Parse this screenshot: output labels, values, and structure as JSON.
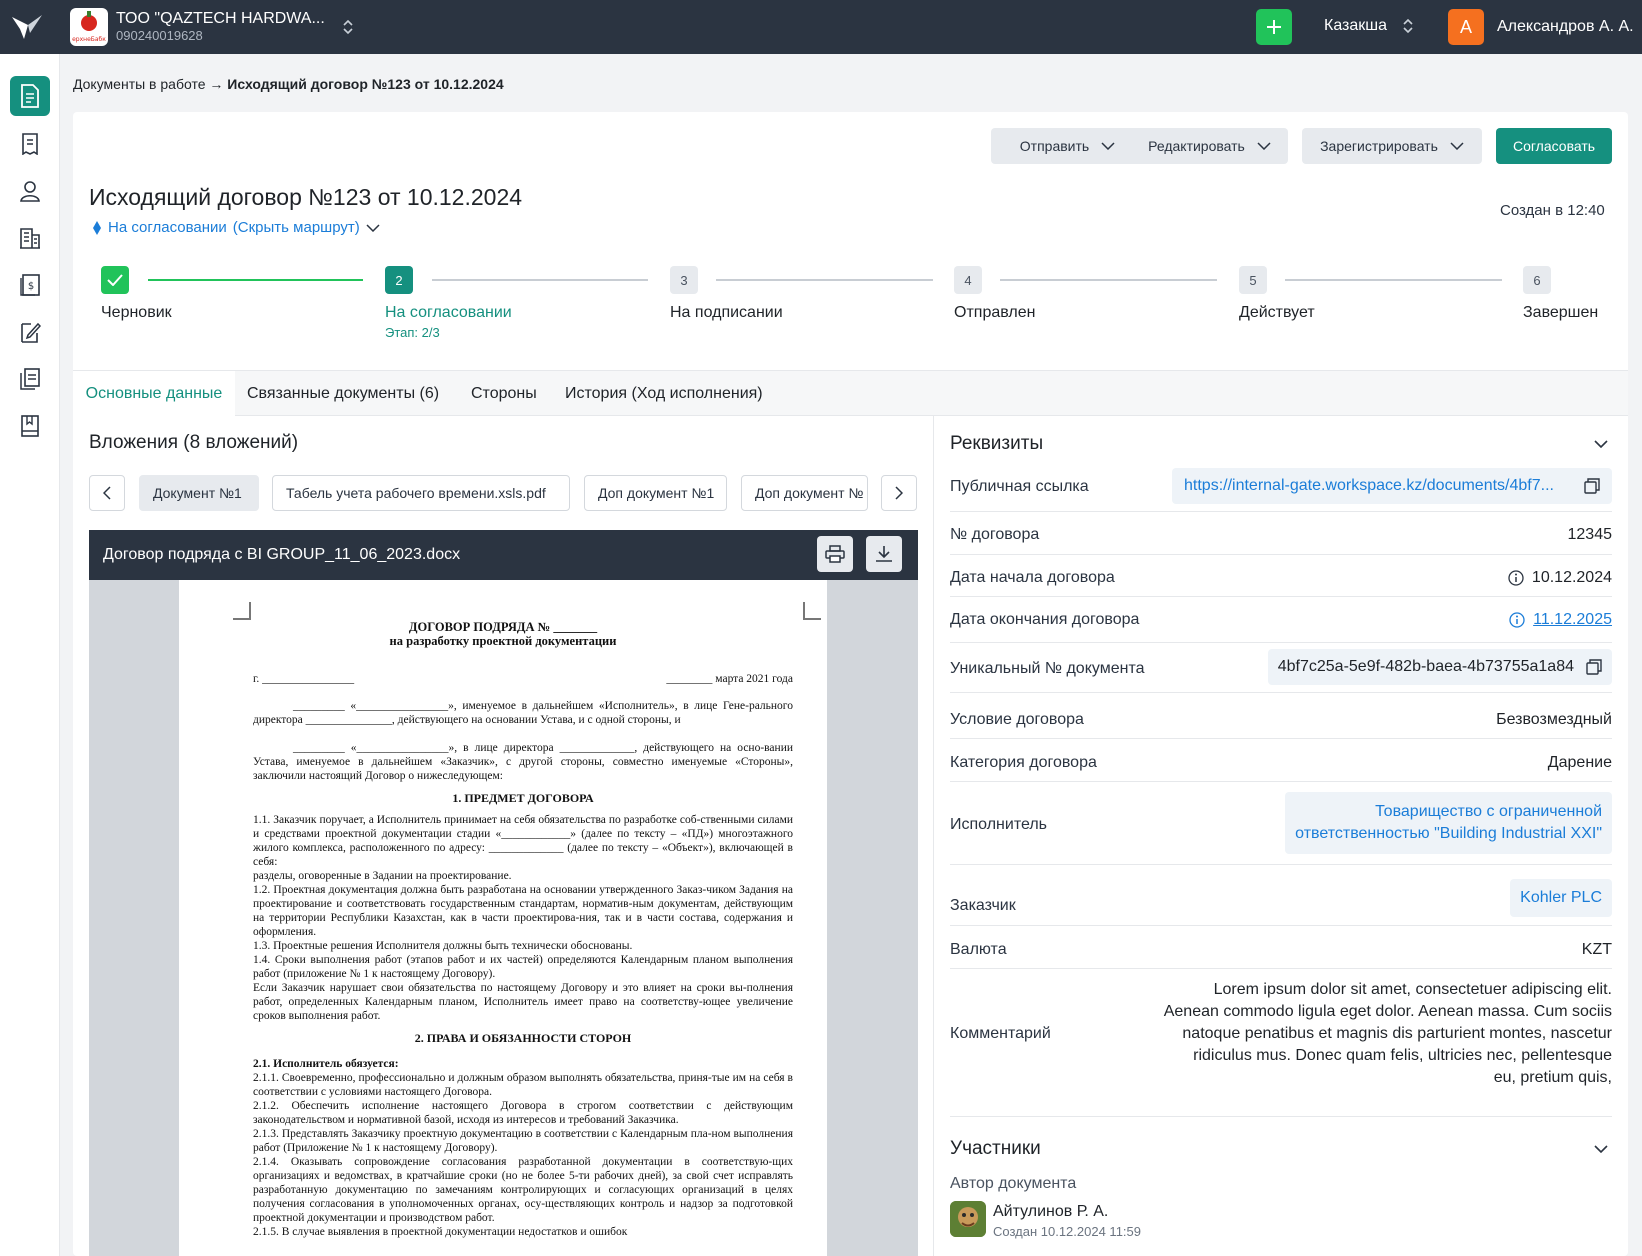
{
  "header": {
    "org_name": "ТОО \"QAZTECH HARDWA...",
    "org_id": "090240019628",
    "org_logo_text": "ерхнеБабк",
    "language": "Казакша",
    "user_initial": "А",
    "user_name": "Александров А. А."
  },
  "sidebar": {
    "items": [
      {
        "icon": "document-icon",
        "active": true
      },
      {
        "icon": "receipt-icon"
      },
      {
        "icon": "user-icon"
      },
      {
        "icon": "building-icon"
      },
      {
        "icon": "invoice-icon"
      },
      {
        "icon": "edit-document-icon"
      },
      {
        "icon": "documents-icon"
      },
      {
        "icon": "bookmark-book-icon"
      }
    ]
  },
  "breadcrumb": {
    "parent": "Документы в работе",
    "arrow": "→",
    "current": "Исходящий договор №123 от 10.12.2024"
  },
  "actions": {
    "send": "Отправить",
    "edit": "Редактировать",
    "register": "Зарегистрировать",
    "approve": "Согласовать"
  },
  "document": {
    "title": "Исходящий договор №123 от 10.12.2024",
    "status": "На согласовании",
    "route_toggle": "(Скрыть маршрут)",
    "created": "Создан в 12:40"
  },
  "stepper": {
    "steps": [
      {
        "num": "1",
        "label": "Черновик",
        "state": "done"
      },
      {
        "num": "2",
        "label": "На согласовании",
        "state": "active",
        "sub": "Этап: 2/3"
      },
      {
        "num": "3",
        "label": "На подписании",
        "state": "pending"
      },
      {
        "num": "4",
        "label": "Отправлен",
        "state": "pending"
      },
      {
        "num": "5",
        "label": "Действует",
        "state": "pending"
      },
      {
        "num": "6",
        "label": "Завершен",
        "state": "pending"
      }
    ]
  },
  "tabs": [
    "Основные данные",
    "Связанные документы (6)",
    "Стороны",
    "История (Ход исполнения)"
  ],
  "attachments": {
    "title": "Вложения (8 вложений)",
    "chips": [
      "Документ №1",
      "Табель учета рабочего времени.xsls.pdf",
      "Доп документ №1",
      "Доп документ №"
    ],
    "viewer_title": "Договор подряда с BI GROUP_11_06_2023.docx"
  },
  "doc_page": {
    "h1": "ДОГОВОР ПОДРЯДА № _______",
    "h2": "на разработку проектной документации",
    "city": "г. ________________",
    "date": "________ марта 2021 года",
    "p1": "_________ «________________», именуемое в дальнейшем «Исполнитель», в лице Гене-рального директора _______________, действующего на основании Устава, и с одной стороны, и",
    "p2": "_________ «________________», в лице директора _____________, действующего на осно-вании Устава, именуемое в дальнейшем «Заказчик», с другой стороны, совместно именуемые «Стороны», заключили настоящий Договор о нижеследующем:",
    "s1": "1.        ПРЕДМЕТ ДОГОВОРА",
    "p3": "1.1.     Заказчик поручает, а Исполнитель принимает на себя обязательства по разработке соб-ственными силами и средствами проектной документации стадии «____________» (далее по тексту – «ПД») многоэтажного жилого комплекса, расположенного по адресу: _____________ (далее по тексту – «Объект»), включающей в себя:",
    "p4": "разделы, оговоренные в Задании на проектирование.",
    "p5": "1.2.     Проектная документация должна быть разработана на основании утвержденного Заказ-чиком Задания на проектирование и соответствовать государственным стандартам, норматив-ным документам, действующим на территории Республики Казахстан, как в части проектирова-ния, так и в части состава, содержания и оформления.",
    "p6": "1.3.     Проектные решения Исполнителя должны быть технически обоснованы.",
    "p7": "1.4.     Сроки выполнения работ (этапов работ и их частей) определяются Календарным планом выполнения работ (приложение № 1 к настоящему Договору).",
    "p8": "Если Заказчик нарушает свои обязательства по настоящему Договору и это влияет на сроки вы-полнения работ, определенных Календарным планом, Исполнитель имеет право на соответству-ющее увеличение сроков выполнения работ.",
    "s2": "2.        ПРАВА И ОБЯЗАННОСТИ СТОРОН",
    "p9": "2.1.      Исполнитель обязуется:",
    "p10": "2.1.1.   Своевременно, профессионально и должным образом выполнять обязательства, приня-тые им на себя в соответствии с условиями настоящего Договора.",
    "p11": "2.1.2.   Обеспечить исполнение настоящего Договора в строгом соответствии с действующим законодательством и нормативной базой, исходя из интересов и требований Заказчика.",
    "p12": "2.1.3.   Представлять Заказчику проектную документацию в соответствии с Календарным пла-ном выполнения работ (Приложение № 1 к настоящему Договору).",
    "p13": "2.1.4.   Оказывать сопровождение согласования разработанной документации в соответствую-щих организациях и ведомствах, в кратчайшие сроки (но не более 5-ти рабочих дней), за свой счет исправлять разработанную документацию по замечаниям контролирующих и согласующих организаций в целях получения согласования в уполномоченных органах, осу-ществляющих контроль и надзор за подготовкой проектной документации и производством работ.",
    "p14": "2.1.5.   В случае выявления в проектной документации недостатков и ошибок"
  },
  "requisites": {
    "title": "Реквизиты",
    "public_link_label": "Публичная ссылка",
    "public_link_value": "https://internal-gate.workspace.kz/documents/4bf7...",
    "contract_no_label": "№ договора",
    "contract_no_value": "12345",
    "start_label": "Дата начала договора",
    "start_value": "10.12.2024",
    "end_label": "Дата  окончания договора",
    "end_value": "11.12.2025",
    "unique_label": "Уникальный № документа",
    "unique_value": "4bf7c25a-5e9f-482b-baea-4b73755a1a84",
    "condition_label": "Условие договора",
    "condition_value": "Безвозмездный",
    "category_label": "Категория договора",
    "category_value": "Дарение",
    "executor_label": "Исполнитель",
    "executor_line1": "Товарищество с ограниченной",
    "executor_line2": "ответственностью \"Building Industrial XXI\"",
    "customer_label": "Заказчик",
    "customer_value": "Kohler PLC",
    "currency_label": "Валюта",
    "currency_value": "KZT",
    "comment_label": "Комментарий",
    "comment_lines": [
      "Lorem ipsum dolor sit amet, consectetuer adipiscing elit.",
      "Aenean commodo ligula eget dolor. Aenean massa. Cum sociis",
      "natoque penatibus et magnis dis parturient montes, nascetur",
      "ridiculus mus. Donec quam felis, ultricies nec, pellentesque",
      "eu, pretium quis,"
    ]
  },
  "participants": {
    "title": "Участники",
    "author_label": "Автор документа",
    "author_name": "Айтулинов Р. А.",
    "author_created": "Создан 10.12.2024 11:59"
  },
  "colors": {
    "accent": "#15907f",
    "success": "#21c35a",
    "link": "#1b7dd8",
    "topbar": "#2b3441",
    "user_avatar": "#f5701f"
  }
}
